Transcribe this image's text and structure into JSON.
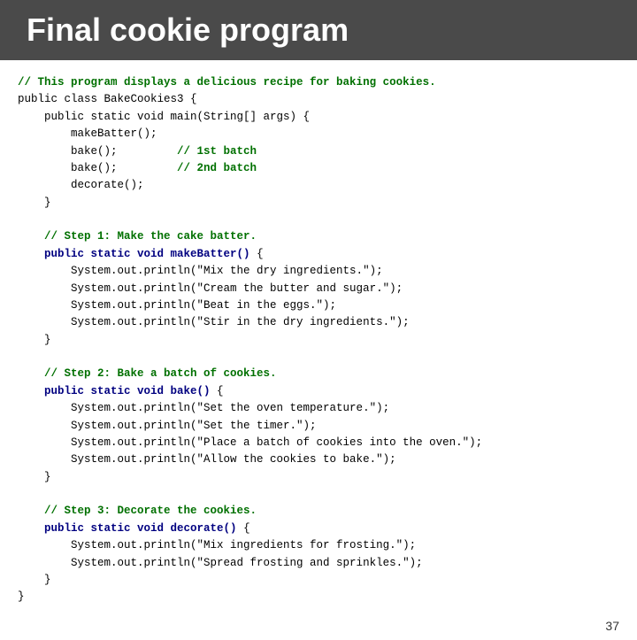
{
  "header": {
    "title": "Final cookie program"
  },
  "code": {
    "lines": [
      {
        "type": "comment",
        "text": "// This program displays a delicious recipe for baking cookies."
      },
      {
        "type": "normal",
        "text": "public class BakeCookies3 {"
      },
      {
        "type": "normal",
        "text": "    public static void main(String[] args) {"
      },
      {
        "type": "normal",
        "text": "        makeBatter();"
      },
      {
        "type": "normal_with_comment",
        "text": "        bake();         ",
        "comment": "// 1st batch"
      },
      {
        "type": "normal_with_comment",
        "text": "        bake();         ",
        "comment": "// 2nd batch"
      },
      {
        "type": "normal",
        "text": "        decorate();"
      },
      {
        "type": "normal",
        "text": "    }"
      },
      {
        "type": "empty",
        "text": ""
      },
      {
        "type": "comment",
        "text": "    // Step 1: Make the cake batter."
      },
      {
        "type": "keyword",
        "text": "    public static void makeBatter() {"
      },
      {
        "type": "normal",
        "text": "        System.out.println(\"Mix the dry ingredients.\");"
      },
      {
        "type": "normal",
        "text": "        System.out.println(\"Cream the butter and sugar.\");"
      },
      {
        "type": "normal",
        "text": "        System.out.println(\"Beat in the eggs.\");"
      },
      {
        "type": "normal",
        "text": "        System.out.println(\"Stir in the dry ingredients.\");"
      },
      {
        "type": "normal",
        "text": "    }"
      },
      {
        "type": "empty",
        "text": ""
      },
      {
        "type": "comment",
        "text": "    // Step 2: Bake a batch of cookies."
      },
      {
        "type": "keyword",
        "text": "    public static void bake() {"
      },
      {
        "type": "normal",
        "text": "        System.out.println(\"Set the oven temperature.\");"
      },
      {
        "type": "normal",
        "text": "        System.out.println(\"Set the timer.\");"
      },
      {
        "type": "normal",
        "text": "        System.out.println(\"Place a batch of cookies into the oven.\");"
      },
      {
        "type": "normal",
        "text": "        System.out.println(\"Allow the cookies to bake.\");"
      },
      {
        "type": "normal",
        "text": "    }"
      },
      {
        "type": "empty",
        "text": ""
      },
      {
        "type": "comment",
        "text": "    // Step 3: Decorate the cookies."
      },
      {
        "type": "keyword",
        "text": "    public static void decorate() {"
      },
      {
        "type": "normal",
        "text": "        System.out.println(\"Mix ingredients for frosting.\");"
      },
      {
        "type": "normal",
        "text": "        System.out.println(\"Spread frosting and sprinkles.\");"
      },
      {
        "type": "normal",
        "text": "    }"
      },
      {
        "type": "normal",
        "text": "}"
      }
    ]
  },
  "footer": {
    "page_number": "37"
  }
}
